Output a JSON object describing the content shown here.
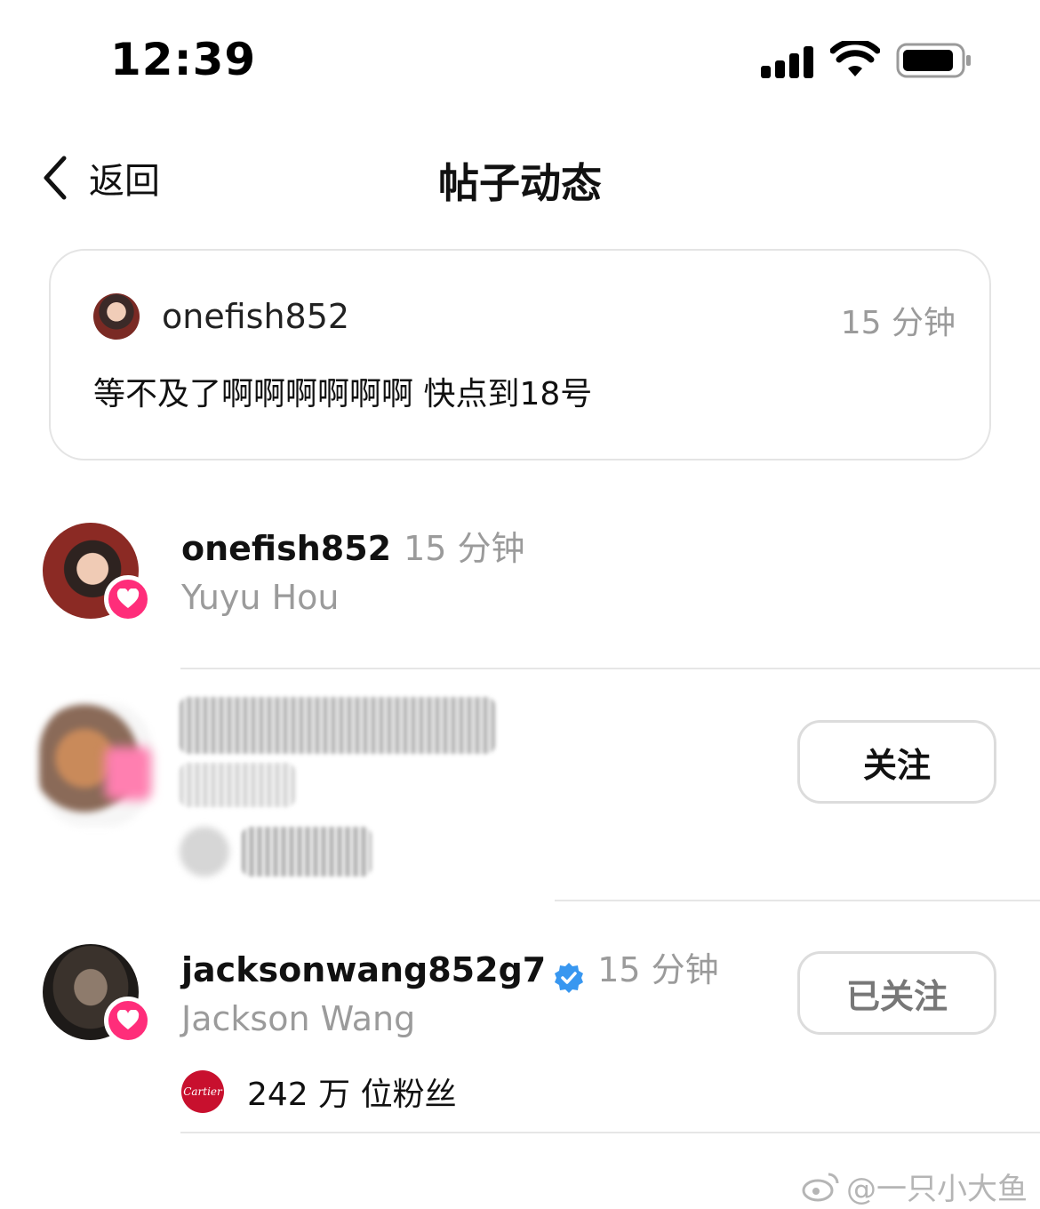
{
  "status_bar": {
    "time": "12:39"
  },
  "nav": {
    "back_label": "返回",
    "title": "帖子动态"
  },
  "post": {
    "username": "onefish852",
    "time": "15 分钟",
    "text": "等不及了啊啊啊啊啊啊 快点到18号"
  },
  "activity": [
    {
      "username": "onefish852",
      "time": "15 分钟",
      "fullname": "Yuyu Hou"
    },
    {
      "follow_label": "关注"
    },
    {
      "username": "jacksonwang852g7",
      "time": "15 分钟",
      "fullname": "Jackson Wang",
      "follow_label": "已关注",
      "followers": "242 万 位粉丝",
      "brand_logo_text": "Cartier"
    }
  ],
  "watermark": "@一只小大鱼",
  "colors": {
    "accent_heart": "#ff2d7a",
    "verified": "#3897f0",
    "brand": "#c8102e"
  }
}
